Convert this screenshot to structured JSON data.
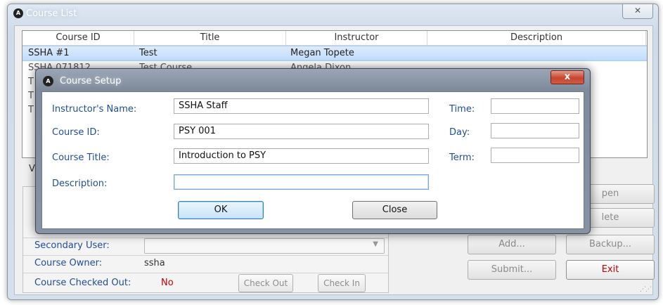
{
  "main_window": {
    "title": "Course List",
    "close_glyph": "✕",
    "logo_text": "A",
    "columns": [
      "Course ID",
      "Title",
      "Instructor",
      "Description"
    ],
    "rows": [
      {
        "course_id": "SSHA #1",
        "title": "Test",
        "instructor": "Megan Topete",
        "description": ""
      },
      {
        "course_id": "SSHA 071812",
        "title": "Test Course",
        "instructor": "Angela Dixon",
        "description": ""
      },
      {
        "course_id": "T",
        "title": "",
        "instructor": "",
        "description": ""
      },
      {
        "course_id": "T",
        "title": "",
        "instructor": "",
        "description": ""
      },
      {
        "course_id": "T",
        "title": "",
        "instructor": "",
        "description": ""
      }
    ],
    "partial_label_v": "V",
    "partial_label_t": "T",
    "secondary_user_label": "Secondary User:",
    "course_owner_label": "Course Owner:",
    "course_owner_value": "ssha",
    "checked_out_label": "Course Checked Out:",
    "checked_out_value": "No",
    "check_out_label": "Check Out",
    "check_in_label": "Check In",
    "open_label": "pen",
    "delete_label": "lete",
    "add_label": "Add...",
    "backup_label": "Backup...",
    "submit_label": "Submit...",
    "exit_label": "Exit",
    "combo_arrow": "▼"
  },
  "dialog": {
    "title": "Course Setup",
    "logo_text": "A",
    "close_glyph": "x",
    "instructor_label": "Instructor's Name:",
    "instructor_value": "SSHA Staff",
    "course_id_label": "Course ID:",
    "course_id_value": "PSY 001",
    "course_title_label": "Course Title:",
    "course_title_value": "Introduction to PSY",
    "description_label": "Description:",
    "description_value": "",
    "time_label": "Time:",
    "time_value": "",
    "day_label": "Day:",
    "day_value": "",
    "term_label": "Term:",
    "term_value": "",
    "ok_label": "OK",
    "close_label": "Close"
  },
  "colors": {
    "label_blue": "#1f4e96",
    "exit_red": "#c00000",
    "selection": "#c1dcfc"
  }
}
